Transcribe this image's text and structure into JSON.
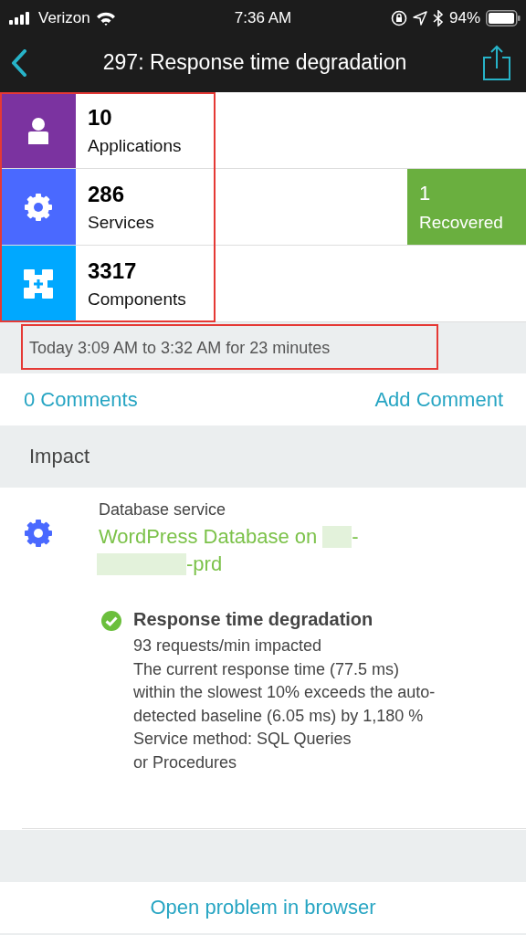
{
  "status_bar": {
    "carrier": "Verizon",
    "time": "7:36 AM",
    "battery": "94%"
  },
  "nav": {
    "title": "297: Response time degradation"
  },
  "stats": [
    {
      "kind": "applications",
      "count": "10",
      "label": "Applications",
      "color": "#7b33a0"
    },
    {
      "kind": "services",
      "count": "286",
      "label": "Services",
      "color": "#4a69ff"
    },
    {
      "kind": "components",
      "count": "3317",
      "label": "Components",
      "color": "#00a8ff"
    }
  ],
  "recovered": {
    "count": "1",
    "label": "Recovered"
  },
  "timeframe": "Today 3:09 AM to 3:32 AM for 23 minutes",
  "comments": {
    "count_link": "0 Comments",
    "add_link": "Add Comment"
  },
  "impact": {
    "heading": "Impact",
    "entity_type": "Database service",
    "entity_name_parts": [
      "WordPress Database on",
      "-",
      "-prd"
    ],
    "event": {
      "resolved": true,
      "title": "Response time degradation",
      "lines": [
        "93 requests/min impacted",
        "The current response time (77.5 ms)",
        "within the slowest 10% exceeds the auto-",
        "detected baseline (6.05 ms) by 1,180 %",
        "Service method: SQL Queries",
        "or Procedures"
      ]
    }
  },
  "footer_link": "Open problem in browser"
}
